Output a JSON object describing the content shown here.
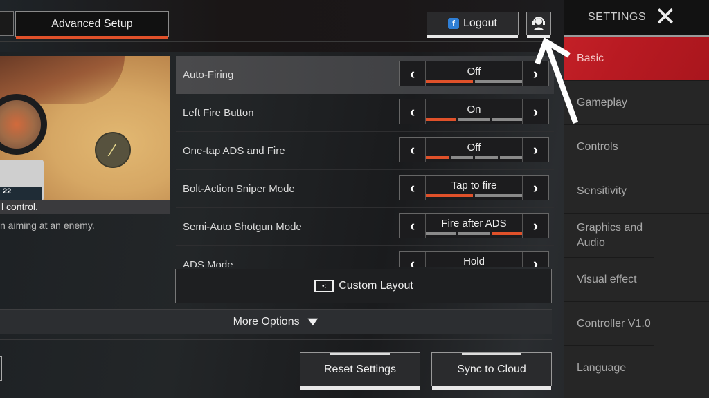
{
  "header": {
    "tab_active": "Advanced Setup",
    "logout_label": "Logout",
    "logout_icon": "facebook-icon",
    "support_icon": "headset-support-icon"
  },
  "preview": {
    "caption": "l control.",
    "hud_text": "22",
    "description": "n aiming at an enemy."
  },
  "settings_rows": [
    {
      "label": "Auto-Firing",
      "value": "Off",
      "segments": 2,
      "active_segment": 1,
      "highlighted": true
    },
    {
      "label": "Left Fire Button",
      "value": "On",
      "segments": 3,
      "active_segment": 1,
      "highlighted": false
    },
    {
      "label": "One-tap ADS and Fire",
      "value": "Off",
      "segments": 4,
      "active_segment": 1,
      "highlighted": false
    },
    {
      "label": "Bolt-Action Sniper Mode",
      "value": "Tap to fire",
      "segments": 2,
      "active_segment": 1,
      "highlighted": false
    },
    {
      "label": "Semi-Auto Shotgun Mode",
      "value": "Fire after ADS",
      "segments": 3,
      "active_segment": 3,
      "highlighted": false
    },
    {
      "label": "ADS Mode",
      "value": "Hold",
      "segments": 2,
      "active_segment": 1,
      "highlighted": false
    }
  ],
  "arrows": {
    "left": "‹",
    "right": "›"
  },
  "custom_layout_label": "Custom Layout",
  "more_options_label": "More Options",
  "buttons": {
    "reset": "Reset Settings",
    "sync": "Sync to Cloud"
  },
  "sidebar": {
    "title": "SETTINGS",
    "close_glyph": "✕",
    "items": [
      {
        "label": "Basic",
        "selected": true
      },
      {
        "label": "Gameplay",
        "selected": false
      },
      {
        "label": "Controls",
        "selected": false
      },
      {
        "label": "Sensitivity",
        "selected": false
      },
      {
        "label": "Graphics and Audio",
        "selected": false
      },
      {
        "label": "Visual effect",
        "selected": false
      },
      {
        "label": "Controller V1.0",
        "selected": false
      },
      {
        "label": "Language",
        "selected": false
      }
    ]
  },
  "colors": {
    "accent_orange": "#e0512a",
    "sidebar_selected_red": "#c32027",
    "sidebar_bg": "#262626"
  }
}
